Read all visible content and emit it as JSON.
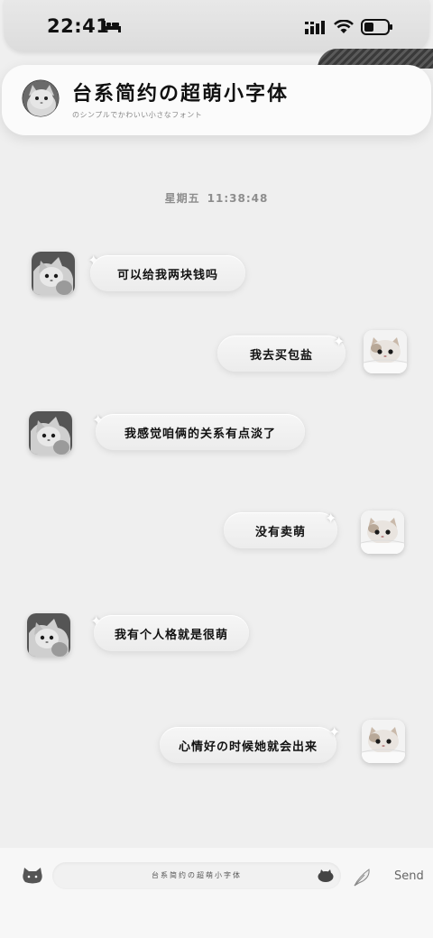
{
  "status_bar": {
    "time": "22:41"
  },
  "header": {
    "title": "台系简约の超萌小字体",
    "subtitle": "のシンプルでかわいい小さなフォント"
  },
  "timestamp": {
    "day": "星期五",
    "time": "11:38:48"
  },
  "messages": [
    {
      "side": "left",
      "text": "可以给我两块钱吗"
    },
    {
      "side": "right",
      "text": "我去买包盐"
    },
    {
      "side": "left",
      "text": "我感觉咱俩的关系有点淡了"
    },
    {
      "side": "right",
      "text": "没有卖萌"
    },
    {
      "side": "left",
      "text": "我有个人格就是很萌"
    },
    {
      "side": "right",
      "text": "心情好の时候她就会出来"
    }
  ],
  "input_bar": {
    "placeholder": "台系简约の超萌小字体",
    "send_label": "Send"
  }
}
